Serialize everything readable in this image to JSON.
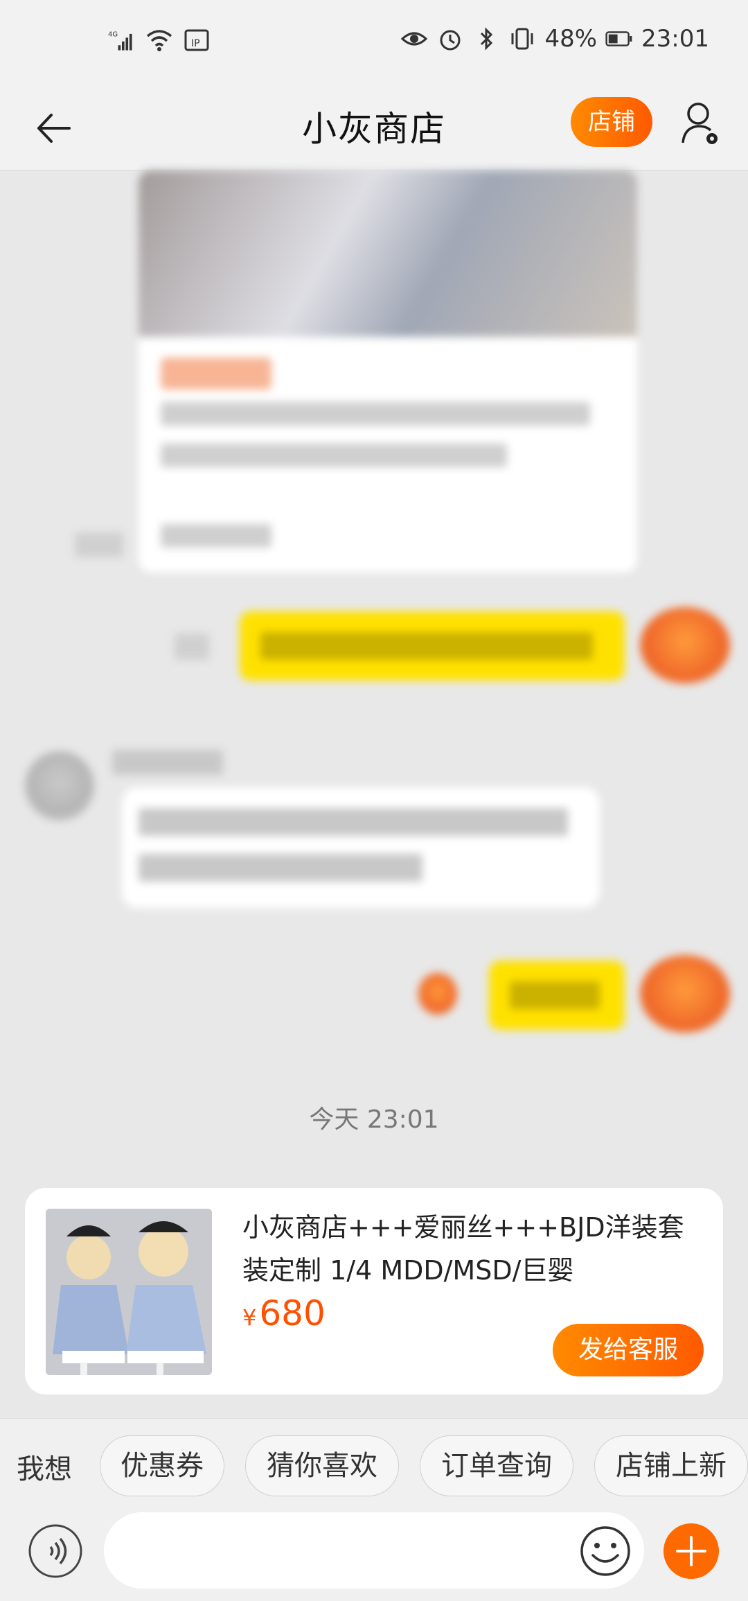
{
  "status_bar": {
    "network": "4G",
    "battery": "48%",
    "time": "23:01"
  },
  "header": {
    "title": "小灰商店",
    "shop_button": "店铺"
  },
  "chat": {
    "timestamp": "今天  23:01"
  },
  "product": {
    "title": "小灰商店+++爱丽丝+++BJD洋装套装定制 1/4 MDD/MSD/巨婴",
    "price_symbol": "¥",
    "price": "680",
    "send_button": "发给客服"
  },
  "quick_replies": {
    "lead": "我想",
    "items": [
      "优惠券",
      "猜你喜欢",
      "订单查询",
      "店铺上新"
    ]
  },
  "input": {
    "placeholder": ""
  },
  "colors": {
    "accent": "#ff6a00",
    "my_bubble": "#ffe100",
    "background": "#e8e8e8"
  },
  "icons": {
    "back": "arrow-left-icon",
    "user_settings": "user-gear-icon",
    "voice": "voice-icon",
    "emoji": "smile-icon",
    "plus": "plus-icon"
  }
}
